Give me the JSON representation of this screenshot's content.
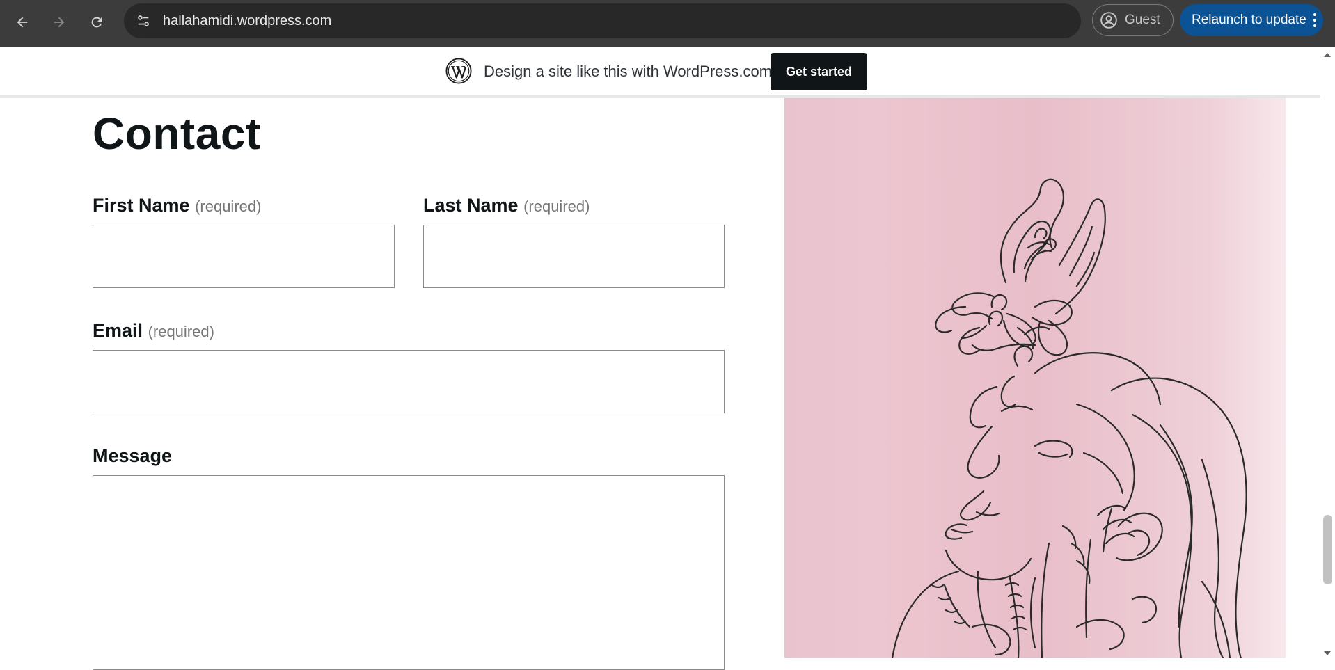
{
  "browser": {
    "url": "hallahamidi.wordpress.com",
    "profile_label": "Guest",
    "update_label": "Relaunch to update",
    "icons": {
      "back": "back-arrow-icon",
      "forward": "forward-arrow-icon",
      "reload": "reload-icon",
      "site_info": "tune-icon",
      "profile": "person-circle-icon",
      "menu": "kebab-menu-icon"
    }
  },
  "wp_banner": {
    "text": "Design a site like this with WordPress.com",
    "button_label": "Get started",
    "logo": "wordpress-logo-icon"
  },
  "page": {
    "title": "Contact",
    "form": {
      "first_name_label": "First Name",
      "last_name_label": "Last Name",
      "email_label": "Email",
      "message_label": "Message",
      "required_note": "(required)"
    }
  },
  "colors": {
    "chrome_bg": "#3c3c3c",
    "relaunch_bg": "#0b5394",
    "button_dark": "#101517",
    "art_pink": "#e8bec9"
  }
}
